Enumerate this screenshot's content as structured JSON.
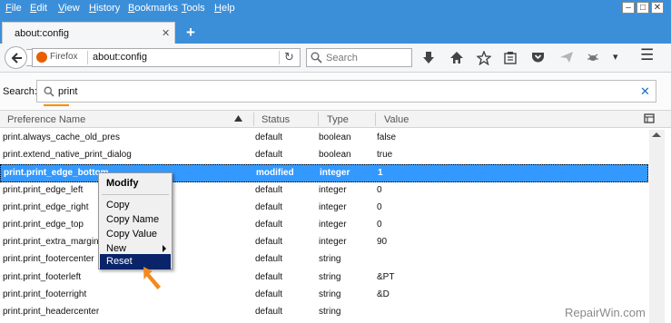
{
  "menubar": {
    "items": [
      {
        "label": "File",
        "u": "F",
        "rest": "ile"
      },
      {
        "label": "Edit",
        "u": "E",
        "rest": "dit"
      },
      {
        "label": "View",
        "u": "V",
        "rest": "iew"
      },
      {
        "label": "History",
        "u": "H",
        "rest": "istory"
      },
      {
        "label": "Bookmarks",
        "u": "B",
        "rest": "ookmarks"
      },
      {
        "label": "Tools",
        "u": "T",
        "rest": "ools"
      },
      {
        "label": "Help",
        "u": "H",
        "rest": "elp"
      }
    ],
    "window_buttons": {
      "minimize": "–",
      "maximize": "□",
      "close": "✕"
    }
  },
  "tab": {
    "title": "about:config",
    "close": "✕",
    "new_tab": "+"
  },
  "navbar": {
    "identity": "Firefox",
    "url": "about:config",
    "reload": "↻",
    "search_placeholder": "Search",
    "overflow": "▾",
    "menu": "☰"
  },
  "config": {
    "search_label": "Search:",
    "search_value": "print",
    "clear": "✕",
    "columns": {
      "name": "Preference Name",
      "status": "Status",
      "type": "Type",
      "value": "Value"
    },
    "rows": [
      {
        "name": "print.always_cache_old_pres",
        "status": "default",
        "type": "boolean",
        "value": "false"
      },
      {
        "name": "print.extend_native_print_dialog",
        "status": "default",
        "type": "boolean",
        "value": "true"
      },
      {
        "name": "print.print_edge_bottom",
        "status": "modified",
        "type": "integer",
        "value": "1"
      },
      {
        "name": "print.print_edge_left",
        "status": "default",
        "type": "integer",
        "value": "0"
      },
      {
        "name": "print.print_edge_right",
        "status": "default",
        "type": "integer",
        "value": "0"
      },
      {
        "name": "print.print_edge_top",
        "status": "default",
        "type": "integer",
        "value": "0"
      },
      {
        "name": "print.print_extra_margin",
        "status": "default",
        "type": "integer",
        "value": "90"
      },
      {
        "name": "print.print_footercenter",
        "status": "default",
        "type": "string",
        "value": ""
      },
      {
        "name": "print.print_footerleft",
        "status": "default",
        "type": "string",
        "value": "&PT"
      },
      {
        "name": "print.print_footerright",
        "status": "default",
        "type": "string",
        "value": "&D"
      },
      {
        "name": "print.print_headercenter",
        "status": "default",
        "type": "string",
        "value": ""
      }
    ]
  },
  "context_menu": {
    "modify": "Modify",
    "copy": "Copy",
    "copy_name": "Copy Name",
    "copy_value": "Copy Value",
    "new": "New",
    "reset": "Reset"
  },
  "watermark": "RepairWin.com",
  "colors": {
    "accent": "#3b8fd9",
    "selection": "#3399ff",
    "menu_highlight": "#0a246a",
    "pointer": "#f28a1e"
  }
}
